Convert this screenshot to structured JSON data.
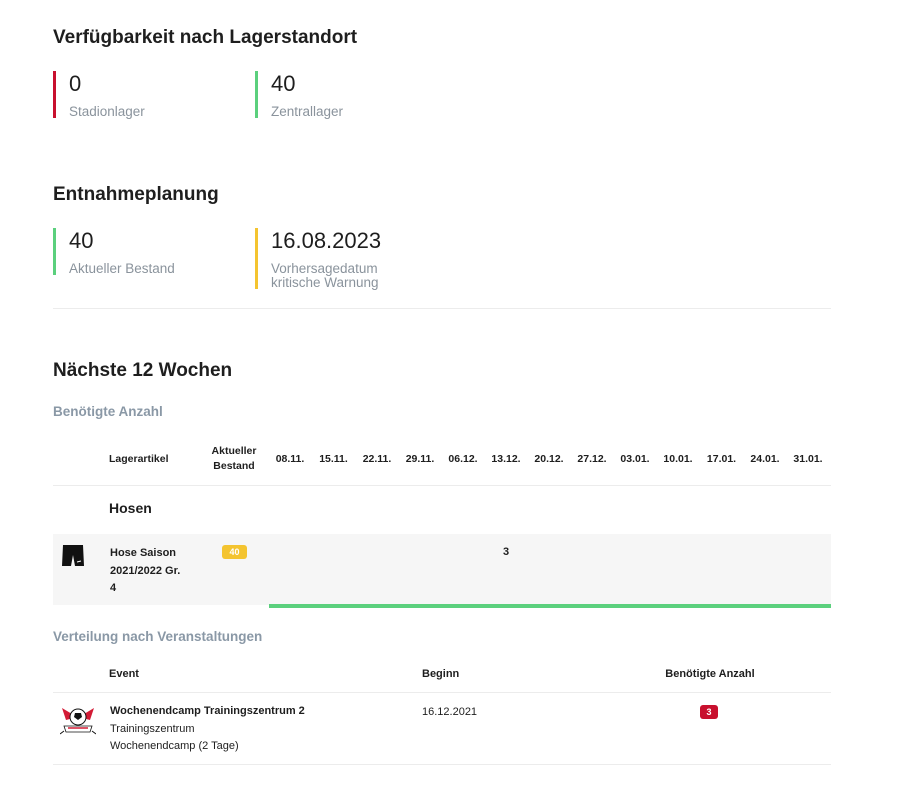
{
  "availability": {
    "title": "Verfügbarkeit nach Lagerstandort",
    "stats": [
      {
        "value": "0",
        "label": "Stadionlager"
      },
      {
        "value": "40",
        "label": "Zentrallager"
      }
    ]
  },
  "planning": {
    "title": "Entnahmeplanung",
    "current_value": "40",
    "current_label": "Aktueller Bestand",
    "forecast_value": "16.08.2023",
    "forecast_label_line1": "Vorhersagedatum",
    "forecast_label_line2": "kritische Warnung"
  },
  "weeks": {
    "title": "Nächste 12 Wochen",
    "subtitle": "Benötigte Anzahl",
    "col_article": "Lagerartikel",
    "col_stock_line1": "Aktueller",
    "col_stock_line2": "Bestand",
    "dates": [
      "08.11.",
      "15.11.",
      "22.11.",
      "29.11.",
      "06.12.",
      "13.12.",
      "20.12.",
      "27.12.",
      "03.01.",
      "10.01.",
      "17.01.",
      "24.01.",
      "31.01."
    ],
    "category": "Hosen",
    "item": {
      "name_line1": "Hose Saison",
      "name_line2": "2021/2022 Gr.",
      "name_line3": "4",
      "stock_badge": "40",
      "demand_week_13_12": "3",
      "icon": "shorts-icon"
    }
  },
  "events": {
    "title": "Verteilung nach Veranstaltungen",
    "col_event": "Event",
    "col_begin": "Beginn",
    "col_needed": "Benötigte Anzahl",
    "rows": [
      {
        "name": "Wochenendcamp Trainingszentrum 2",
        "location": "Trainingszentrum",
        "type": "Wochenendcamp (2 Tage)",
        "begin": "16.12.2021",
        "needed": "3",
        "icon": "club-crest-icon"
      }
    ]
  },
  "colors": {
    "red": "#c8102e",
    "green": "#5bd07d",
    "yellow": "#f4c430",
    "muted": "#8a98a6"
  }
}
